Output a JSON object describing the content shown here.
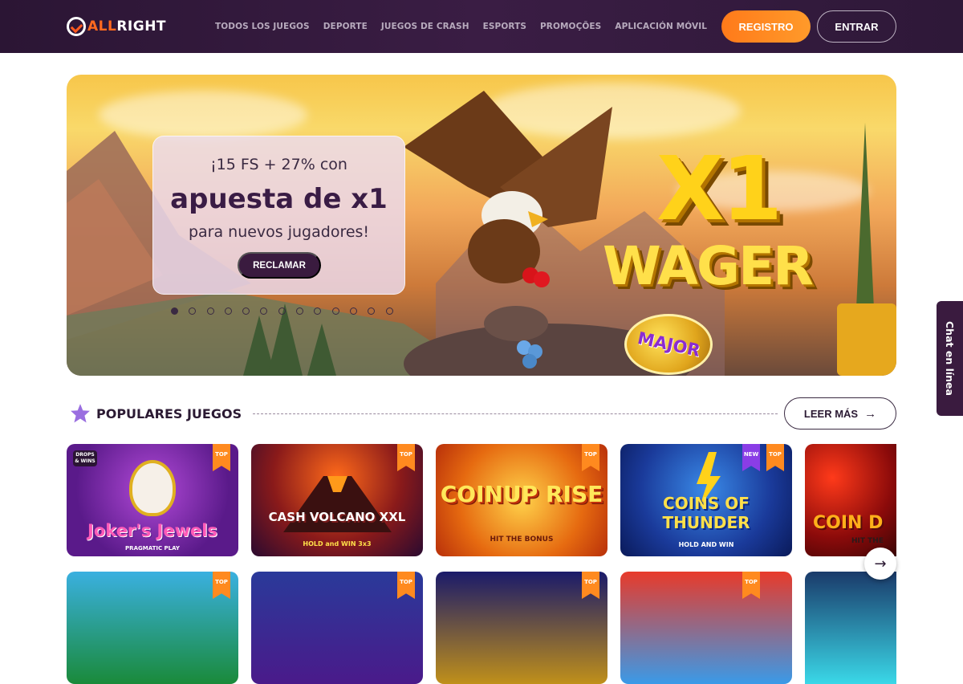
{
  "header": {
    "logo_part1": "ALL",
    "logo_part2": "RIGHT",
    "nav": [
      "TODOS LOS JUEGOS",
      "DEPORTE",
      "JUEGOS DE CRASH",
      "ESPORTS",
      "PROMOÇÕES",
      "APLICACIÓN MÓVIL"
    ],
    "register_label": "REGISTRO",
    "login_label": "ENTRAR"
  },
  "banner": {
    "line1": "¡15 FS + 27% con",
    "line2": "apuesta de x1",
    "line3": "para nuevos jugadores!",
    "claim_label": "RECLAMAR",
    "slide_count": 13,
    "active_slide": 1,
    "art_x1": "X1",
    "art_wager": "WAGER",
    "art_major": "MAJOR"
  },
  "chat": {
    "label": "Chat en línea"
  },
  "section": {
    "title": "POPULARES JUEGOS",
    "more_label": "LEER MÁS",
    "more_arrow": "→"
  },
  "games_row1": [
    {
      "title": "Joker's Jewels",
      "provider": "PRAGMATIC PLAY",
      "badge": "TOP",
      "tag": "DROPS & WINS"
    },
    {
      "title": "CASH VOLCANO XXL",
      "sub": "HOLD and WIN 3x3",
      "badge": "TOP"
    },
    {
      "title": "COINUP RISE",
      "sub": "HIT THE BONUS",
      "badge": "TOP"
    },
    {
      "title": "COINS OF THUNDER",
      "sub": "HOLD AND WIN",
      "badge": "TOP",
      "badge_new": "NEW"
    },
    {
      "title": "COIN D",
      "sub": "HIT THE"
    }
  ],
  "games_row2_badges": [
    "TOP",
    "TOP",
    "TOP",
    "TOP"
  ],
  "carousel_next": "→",
  "colors": {
    "header_bg": "#2b1534",
    "accent": "#ff7a1a",
    "dark": "#3a1b3f"
  }
}
